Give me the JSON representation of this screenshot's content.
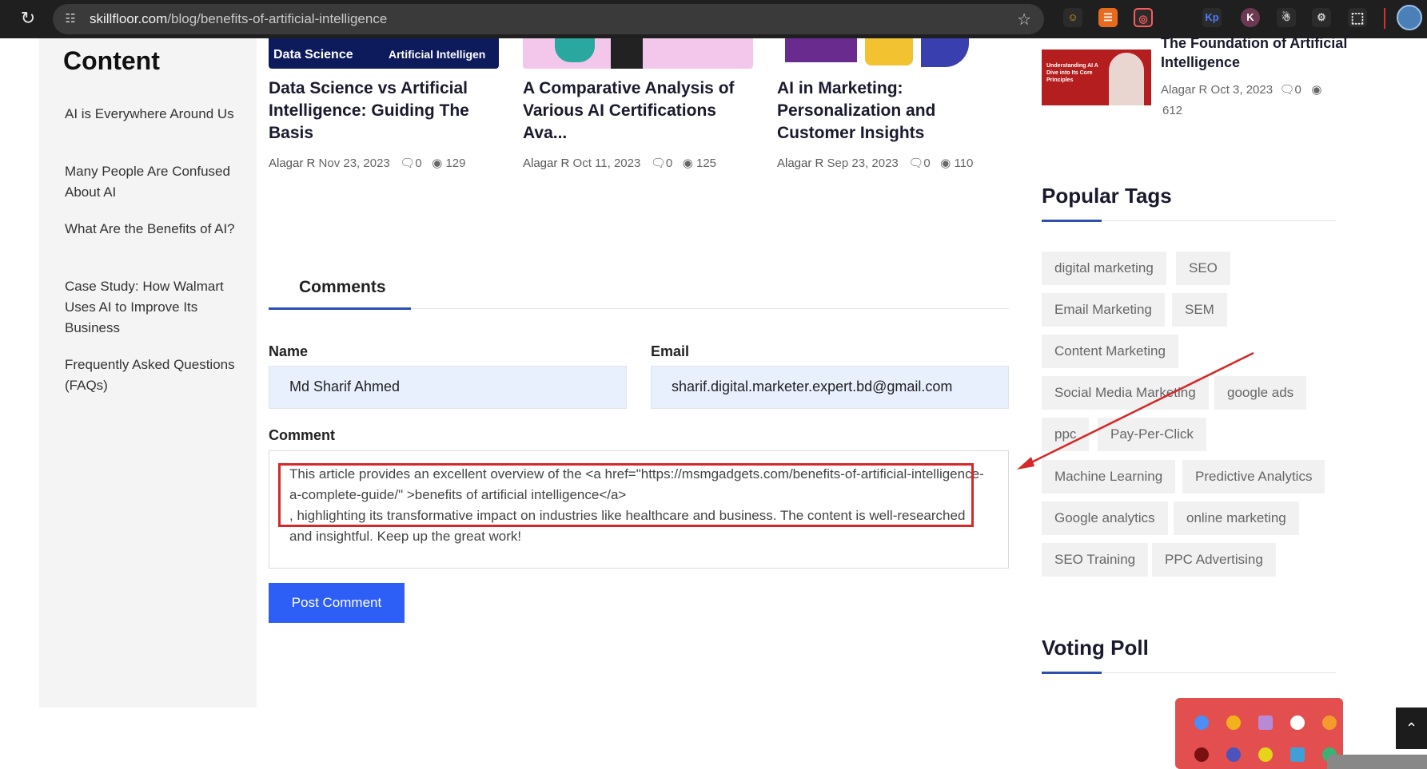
{
  "browser": {
    "url_host": "skillfloor.com",
    "url_path": "/blog/benefits-of-artificial-intelligence"
  },
  "toc": {
    "title": "Content",
    "items": [
      "AI is Everywhere Around Us",
      "Many People Are Confused About AI",
      "What Are the Benefits of AI?",
      "Case Study: How Walmart Uses AI to Improve Its Business",
      "Frequently Asked Questions (FAQs)"
    ]
  },
  "related": [
    {
      "tag_left": "Data Science",
      "tag_right": "Artificial Intelligen",
      "title": "Data Science vs Artificial Intelligence: Guiding The Basis",
      "author": "Alagar R",
      "date": "Nov 23, 2023",
      "comments": "0",
      "views": "129"
    },
    {
      "title": "A Comparative Analysis of Various AI Certifications Ava...",
      "author": "Alagar R",
      "date": "Oct 11, 2023",
      "comments": "0",
      "views": "125"
    },
    {
      "title": "AI in Marketing: Personalization and Customer Insights",
      "author": "Alagar R",
      "date": "Sep 23, 2023",
      "comments": "0",
      "views": "110"
    }
  ],
  "comments": {
    "tab_label": "Comments",
    "name_label": "Name",
    "name_value": "Md Sharif Ahmed",
    "email_label": "Email",
    "email_value": "sharif.digital.marketer.expert.bd@gmail.com",
    "comment_label": "Comment",
    "comment_value": "This article provides an excellent overview of the <a href=\"https://msmgadgets.com/benefits-of-artificial-intelligence-a-complete-guide/\" >benefits of artificial intelligence</a>\n, highlighting its transformative impact on industries like healthcare and business. The content is well-researched and insightful. Keep up the great work!",
    "submit_label": "Post Comment"
  },
  "sidebar": {
    "featured": {
      "title": "The Foundation of Artificial Intelligence",
      "thumb_text": "Understanding AI A Dive into Its Core Principles",
      "author": "Alagar R",
      "date": "Oct 3, 2023",
      "comments": "0",
      "views": "612"
    },
    "popular_tags_heading": "Popular Tags",
    "tags": [
      "digital marketing",
      "SEO",
      "Email Marketing",
      "SEM",
      "Content Marketing",
      "Social Media Marketing",
      "google ads",
      "ppc",
      "Pay-Per-Click",
      "Machine Learning",
      "Predictive Analytics",
      "Google analytics",
      "online marketing",
      "SEO Training",
      "PPC Advertising"
    ],
    "voting_heading": "Voting Poll"
  },
  "colors": {
    "accent": "#2c4fb0",
    "button": "#2d5ef5",
    "annotation": "#d62828"
  }
}
